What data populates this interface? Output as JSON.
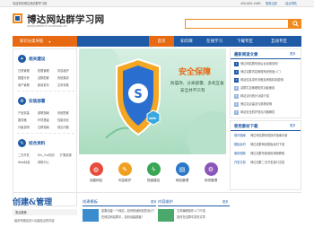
{
  "topbar": {
    "welcome": "欢迎来到博达网站群学习网",
    "phone": "400-600-1060",
    "login": "登录注册",
    "help": "站点导航"
  },
  "header": {
    "site_title": "博达网站群学习网",
    "site_subtitle": "WWW.WEBSITE.LEARNING.CN"
  },
  "search": {
    "placeholder": ""
  },
  "nav": {
    "category": "知识分类导航",
    "items": [
      {
        "label": "首页"
      },
      {
        "label": "知识库"
      },
      {
        "label": "在线学习"
      },
      {
        "label": "下载专区"
      },
      {
        "label": "互动专区"
      }
    ]
  },
  "sidebar": {
    "sections": [
      {
        "title": "相关建设",
        "links": [
          "日常管理",
          "权限管理",
          "内容维护",
          "数据分析",
          "站群配置",
          "系统集成",
          "用户管理",
          "新闻发布",
          "文章采集"
        ]
      },
      {
        "title": "安装部署",
        "links": [
          "产品安装",
          "部署指南",
          "系统配置",
          "服务器",
          "环境搭建",
          "性能优化",
          "升级说明",
          "迁移指南",
          "常见问题"
        ]
      },
      {
        "title": "综合资料",
        "links": [
          "二次开发",
          "Div_Css知识",
          "扩展资源",
          "Web标准",
          "帮助中心"
        ]
      }
    ]
  },
  "banner": {
    "headline": "安全保障",
    "line1": "防篡改、分离部署、多机互备",
    "line2": "安全并不只有",
    "badge": "safe"
  },
  "right": {
    "recommend_title": "最新阅读文章",
    "recommend_more": "更多",
    "recommend_items": [
      "博达网站群系统后台设置说明",
      "博达站群内容管理系统快速入门",
      "网站信息发布流程及审核机制说明",
      "站群栏目管理相关功能使用",
      "网站访问统计功能介绍",
      "博达站点建设与部署说明",
      "网站安全防护常见问题解答"
    ],
    "download_title": "使用素材下载",
    "download_more": "更多",
    "download_items": [
      {
        "name": "操作指南",
        "desc": "博达网站群系统操作指南手册"
      },
      {
        "name": "模板素材",
        "desc": "博达站群网站模板素材下载"
      },
      {
        "name": "使用视频",
        "desc": "博达站群系统使用视频教程"
      },
      {
        "name": "开发文档",
        "desc": "博达站群二次开发接口文档"
      }
    ]
  },
  "tools": [
    {
      "label": "创建网站",
      "icon": "globe-icon",
      "color": "#e64b3c"
    },
    {
      "label": "内容维护",
      "icon": "edit-icon",
      "color": "#f0a020"
    },
    {
      "label": "快速建站",
      "icon": "bolt-icon",
      "color": "#3aa655"
    },
    {
      "label": "网站管理",
      "icon": "manage-icon",
      "color": "#2a78c8"
    },
    {
      "label": "系统管理",
      "icon": "gear-icon",
      "color": "#8a57b8"
    }
  ],
  "bottom": {
    "section_title": "创建&管理",
    "subtab": "重点推荐",
    "link1": "建设专题站怎么创建站点的内容",
    "col2_title": "创建模板",
    "col2_more": "更多",
    "col2_items": [
      "如果创建一个网站，如何快速网站的设计？",
      "在博达网站群中，如何创建模板？"
    ],
    "col3_title": "内容维护",
    "col3_more": "更多",
    "col3_items": [
      "文章编辑操作入门介绍",
      "如何在站群中发布文章"
    ]
  },
  "colors": {
    "brand_blue": "#1f5aa6",
    "accent_orange": "#e76a12"
  }
}
